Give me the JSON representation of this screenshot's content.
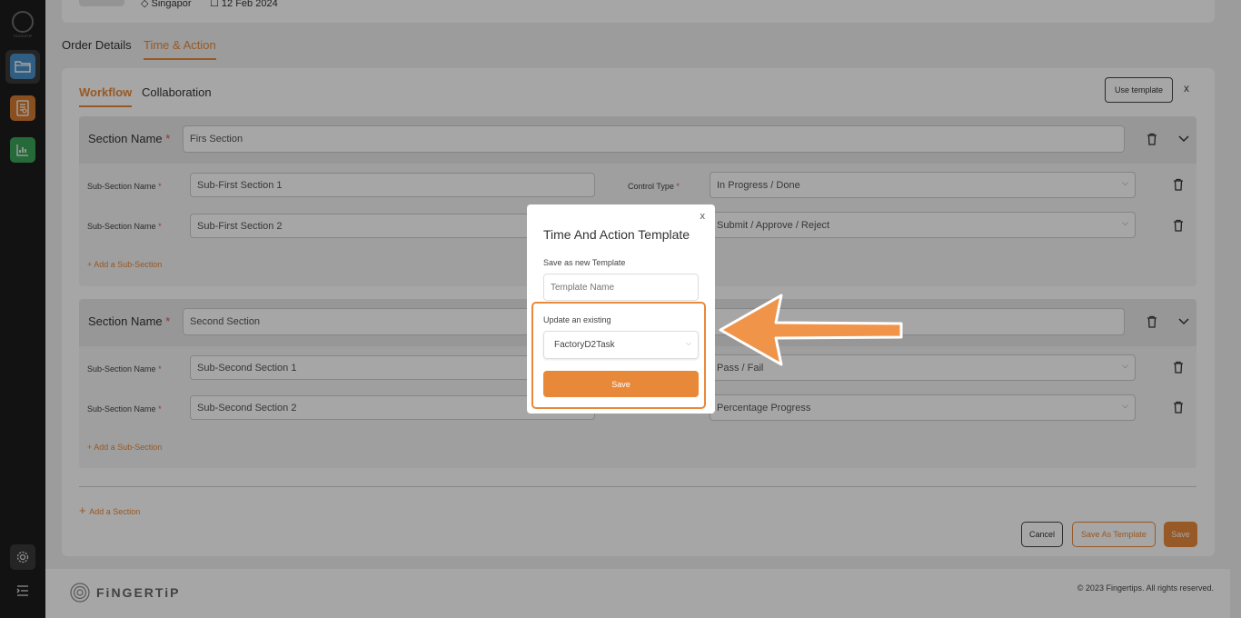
{
  "app": {
    "logo_text": "FiNGERTiP",
    "brand_name": "FiNGERTiP",
    "copyright": "© 2023 Fingertips. All rights reserved."
  },
  "top": {
    "location": "Singapor",
    "date": "12 Feb 2024"
  },
  "tabs": [
    {
      "label": "Order Details",
      "active": false
    },
    {
      "label": "Time & Action",
      "active": true
    }
  ],
  "subtabs": [
    {
      "label": "Workflow",
      "active": true
    },
    {
      "label": "Collaboration",
      "active": false
    }
  ],
  "use_template_label": "Use template",
  "close_label": "x",
  "sections": [
    {
      "label": "Section Name",
      "value": "Firs Section",
      "subsections": [
        {
          "label": "Sub-Section Name",
          "value": "Sub-First Section 1",
          "control_label": "Control Type",
          "control": "In Progress / Done"
        },
        {
          "label": "Sub-Section Name",
          "value": "Sub-First Section 2",
          "control_label": "",
          "control": "Submit / Approve / Reject"
        }
      ],
      "add_sub_label": "Add a Sub-Section"
    },
    {
      "label": "Section Name",
      "value": "Second Section",
      "subsections": [
        {
          "label": "Sub-Section Name",
          "value": "Sub-Second Section 1",
          "control_label": "",
          "control": "Pass / Fail"
        },
        {
          "label": "Sub-Section Name",
          "value": "Sub-Second Section 2",
          "control_label": "",
          "control": "Percentage Progress"
        }
      ],
      "add_sub_label": "Add a Sub-Section"
    }
  ],
  "add_section_label": "Add a Section",
  "actions": {
    "cancel": "Cancel",
    "save_as_template": "Save As Template",
    "save": "Save"
  },
  "modal": {
    "close": "x",
    "title": "Time And Action Template",
    "save_new_label": "Save as new Template",
    "template_name_placeholder": "Template Name",
    "update_label": "Update an existing",
    "selected_template": "FactoryD2Task",
    "save_label": "Save"
  },
  "colors": {
    "accent": "#e8893a",
    "sidebar": "#1d1d1d",
    "sb_blue": "#4a90c8",
    "sb_orange": "#d47a30",
    "sb_green": "#3da35a"
  },
  "icons": [
    "folder-icon",
    "report-icon",
    "chart-icon",
    "gear-icon",
    "menu-icon",
    "trash-icon",
    "chevron-down-icon",
    "plus-icon",
    "location-icon",
    "calendar-icon"
  ]
}
